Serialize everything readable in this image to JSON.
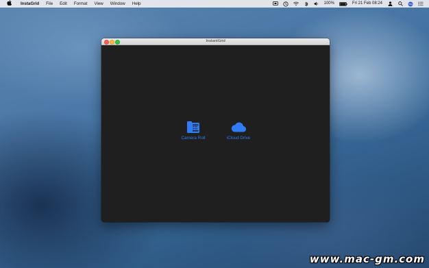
{
  "menubar": {
    "app_name": "InstaGrid",
    "menus": [
      "File",
      "Edit",
      "Format",
      "View",
      "Window",
      "Help"
    ],
    "battery_percent": "100%",
    "datetime": "Fri 21 Feb  08:24"
  },
  "window": {
    "title": "InstantGrid"
  },
  "sources": {
    "camera_roll": "Camera Roll",
    "icloud_drive": "iCloud Drive"
  },
  "watermark": "www.mac-gm.com",
  "colors": {
    "accent": "#2f7cf6",
    "window_bg": "#1f1f1f"
  }
}
